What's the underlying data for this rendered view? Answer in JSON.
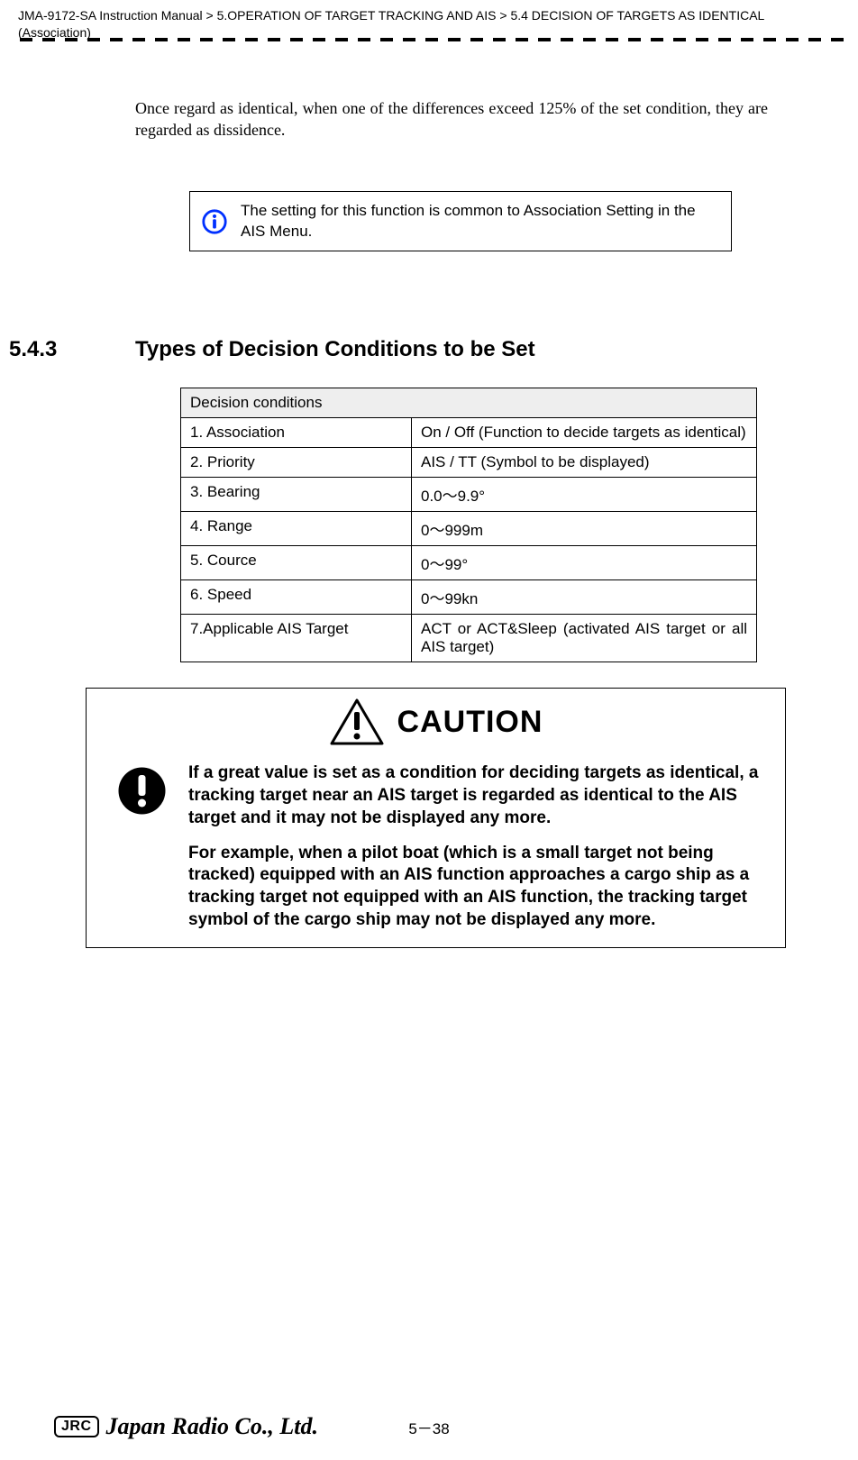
{
  "header": {
    "path": "JMA-9172-SA Instruction Manual > 5.OPERATION OF TARGET TRACKING AND AIS > 5.4  DECISION OF TARGETS AS IDENTICAL (Association)"
  },
  "body": {
    "para1": "Once regard as identical, when one of the differences exceed 125% of the set condition, they are regarded as dissidence."
  },
  "info": {
    "text": "The setting for this function is common to Association Setting in the AIS Menu."
  },
  "section": {
    "number": "5.4.3",
    "title": "Types of Decision Conditions to be Set"
  },
  "table": {
    "header": "Decision conditions",
    "rows": [
      {
        "label": "1. Association",
        "value": "On / Off (Function to decide targets as identical)",
        "justify": true
      },
      {
        "label": "2. Priority",
        "value": "AIS / TT (Symbol to be displayed)"
      },
      {
        "label": "3. Bearing",
        "value": "0.0～9.9°"
      },
      {
        "label": "4. Range",
        "value": "0～999m"
      },
      {
        "label": "5. Cource",
        "value": "0～99°"
      },
      {
        "label": "6. Speed",
        "value": "0～99kn"
      },
      {
        "label": "7.Applicable AIS Target",
        "value": "ACT or ACT&Sleep (activated AIS target or all AIS target)",
        "justify": true
      }
    ]
  },
  "caution": {
    "word": "CAUTION",
    "p1": "If a great value is set as a condition for deciding targets as identical, a tracking target near an AIS target is regarded as identical to the AIS target and it may not be displayed any more.",
    "p2": "For example, when a pilot boat (which is a small target not being tracked) equipped with an AIS function approaches a cargo ship as a tracking target not equipped with an AIS function, the tracking target symbol of the cargo ship may not be displayed any more."
  },
  "footer": {
    "brand_box": "JRC",
    "brand_script": "Japan Radio Co., Ltd.",
    "page": "5－38"
  }
}
